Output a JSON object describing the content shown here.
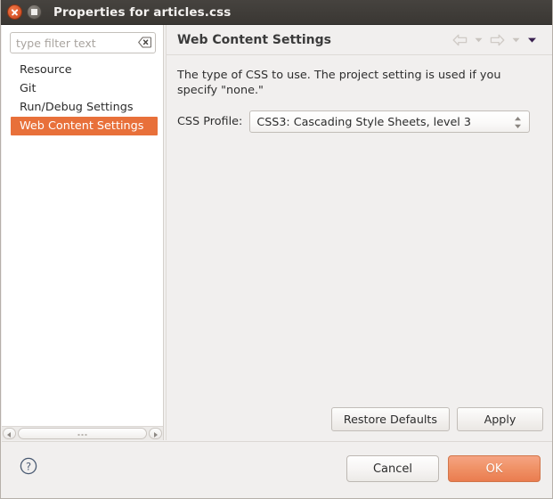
{
  "window": {
    "title": "Properties for articles.css",
    "close_icon": "close-icon",
    "maximize_icon": "maximize-icon"
  },
  "sidebar": {
    "filter": {
      "value": "",
      "placeholder": "type filter text",
      "clear_icon": "clear-backspace-icon"
    },
    "items": [
      {
        "label": "Resource",
        "selected": false
      },
      {
        "label": "Git",
        "selected": false
      },
      {
        "label": "Run/Debug Settings",
        "selected": false
      },
      {
        "label": "Web Content Settings",
        "selected": true
      }
    ],
    "scrollbar": {
      "left_arrow_icon": "scroll-left-arrow-icon",
      "right_arrow_icon": "scroll-right-arrow-icon",
      "thumb_grip_icon": "scrollbar-grip-icon"
    }
  },
  "main": {
    "title": "Web Content Settings",
    "nav": {
      "back_icon": "back-arrow-icon",
      "back_menu_icon": "back-dropdown-caret-icon",
      "forward_icon": "forward-arrow-icon",
      "forward_menu_icon": "forward-dropdown-caret-icon",
      "menu_icon": "view-menu-caret-icon"
    },
    "description": "The type of CSS to use.  The project setting is used if you specify \"none.\"",
    "css_profile": {
      "label": "CSS Profile:",
      "value": "CSS3: Cascading Style Sheets, level 3",
      "spinner_icon": "combo-spinner-icon",
      "options": [
        "CSS3: Cascading Style Sheets, level 3"
      ]
    },
    "restore_defaults_label": "Restore Defaults",
    "apply_label": "Apply"
  },
  "footer": {
    "help_icon": "help-question-icon",
    "cancel_label": "Cancel",
    "ok_label": "OK"
  },
  "colors": {
    "titlebar": "#3c3934",
    "selection_orange": "#e8703a",
    "ok_button_orange": "#ea7c4f",
    "panel_background": "#f1efee",
    "tree_background": "#ffffff"
  }
}
